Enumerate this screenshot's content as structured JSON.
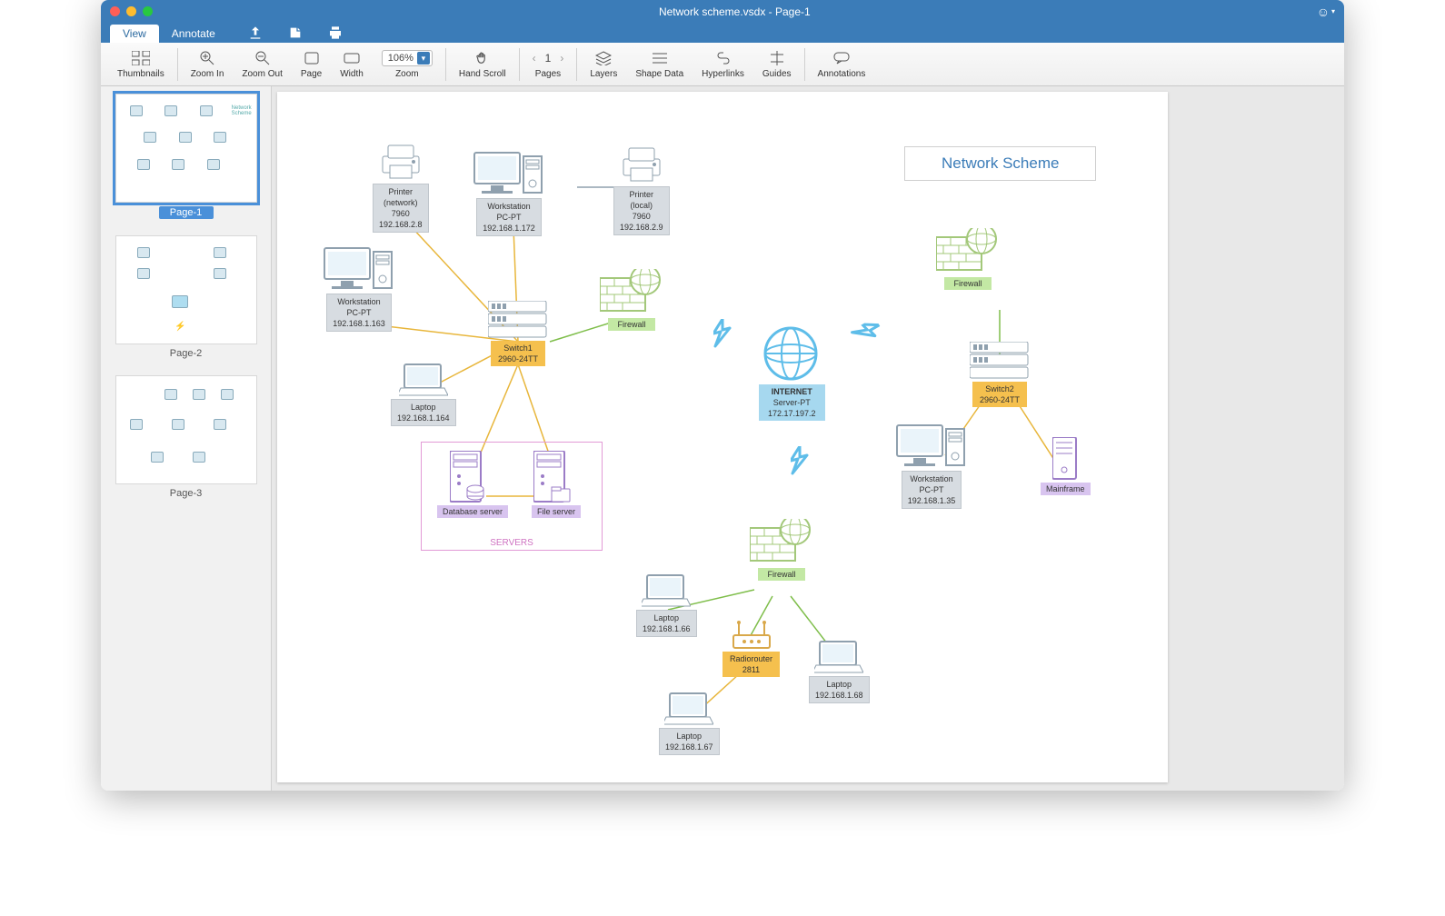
{
  "window_title": "Network scheme.vsdx - Page-1",
  "tabs": {
    "view": "View",
    "annotate": "Annotate"
  },
  "toolbar": {
    "thumbnails": "Thumbnails",
    "zoom_in": "Zoom In",
    "zoom_out": "Zoom Out",
    "page": "Page",
    "width": "Width",
    "zoom": "Zoom",
    "zoom_value": "106%",
    "hand_scroll": "Hand Scroll",
    "pages": "Pages",
    "page_current": "1",
    "layers": "Layers",
    "shape_data": "Shape Data",
    "hyperlinks": "Hyperlinks",
    "guides": "Guides",
    "annotations": "Annotations"
  },
  "sidebar": {
    "pages": [
      {
        "label": "Page-1",
        "selected": true
      },
      {
        "label": "Page-2",
        "selected": false
      },
      {
        "label": "Page-3",
        "selected": false
      }
    ]
  },
  "diagram": {
    "title": "Network Scheme",
    "servers_label": "SERVERS",
    "nodes": {
      "printer_network": {
        "name": "Printer",
        "subtype": "(network)",
        "model": "7960",
        "ip": "192.168.2.8"
      },
      "workstation1": {
        "name": "Workstation",
        "subtype": "PC-PT",
        "ip": "192.168.1.172"
      },
      "printer_local": {
        "name": "Printer",
        "subtype": "(local)",
        "model": "7960",
        "ip": "192.168.2.9"
      },
      "workstation2": {
        "name": "Workstation",
        "subtype": "PC-PT",
        "ip": "192.168.1.163"
      },
      "laptop1": {
        "name": "Laptop",
        "ip": "192.168.1.164"
      },
      "switch1": {
        "name": "Switch1",
        "model": "2960-24TT"
      },
      "firewall1": {
        "name": "Firewall"
      },
      "db_server": {
        "name": "Database server"
      },
      "file_server": {
        "name": "File server"
      },
      "internet": {
        "name": "INTERNET",
        "subtype": "Server-PT",
        "ip": "172.17.197.2"
      },
      "firewall2": {
        "name": "Firewall"
      },
      "switch2": {
        "name": "Switch2",
        "model": "2960-24TT"
      },
      "workstation3": {
        "name": "Workstation",
        "subtype": "PC-PT",
        "ip": "192.168.1.35"
      },
      "mainframe": {
        "name": "Mainframe"
      },
      "firewall3": {
        "name": "Firewall"
      },
      "laptop2": {
        "name": "Laptop",
        "ip": "192.168.1.66"
      },
      "radiorouter": {
        "name": "Radiorouter",
        "model": "2811"
      },
      "laptop3": {
        "name": "Laptop",
        "ip": "192.168.1.68"
      },
      "laptop4": {
        "name": "Laptop",
        "ip": "192.168.1.67"
      }
    }
  }
}
